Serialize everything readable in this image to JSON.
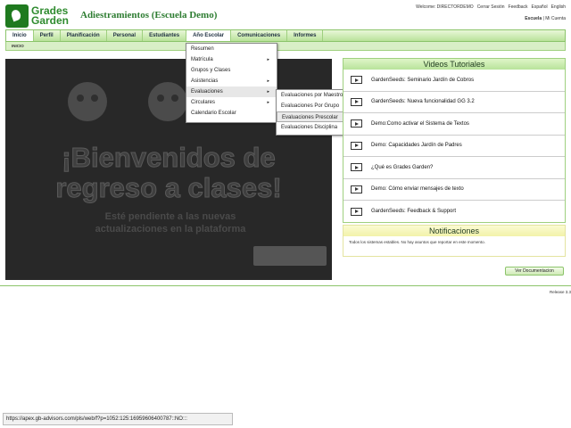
{
  "header": {
    "logo_line1": "Grades",
    "logo_line2": "Garden",
    "app_title": "Adiestramientos (Escuela Demo)",
    "welcome": "Welcome: DIRECTORDEMO",
    "logout": "Cerrar Sesión",
    "feedback": "Feedback",
    "lang_es": "Español",
    "lang_en": "English",
    "school": "Escuela",
    "separator": "|",
    "my_account": "Mi Cuenta"
  },
  "nav": {
    "items": [
      "Inicio",
      "Perfil",
      "Planificación",
      "Personal",
      "Estudiantes",
      "Año Escolar",
      "Comunicaciones",
      "Informes"
    ],
    "breadcrumb": "INICIO"
  },
  "menu_main": {
    "items": [
      {
        "label": "Resumen",
        "arrow": ""
      },
      {
        "label": "Matrícula",
        "arrow": "▸"
      },
      {
        "label": "Grupos y Clases",
        "arrow": ""
      },
      {
        "label": "Asistencias",
        "arrow": "▸"
      },
      {
        "label": "Evaluaciones",
        "arrow": "▸"
      },
      {
        "label": "Circulares",
        "arrow": "▸"
      },
      {
        "label": "Calendario Escolar",
        "arrow": ""
      }
    ]
  },
  "menu_sub": {
    "items": [
      "Evaluaciones por Maestro",
      "Evaluaciones Por Grupo",
      "Evaluaciones Prescolar",
      "Evaluaciones Disciplina"
    ]
  },
  "banner": {
    "line1": "¡Bienvenidos de",
    "line2": "regreso a clases!",
    "sub1": "Esté pendiente a las nuevas",
    "sub2": "actualizaciones en la plataforma"
  },
  "videos": {
    "title": "Videos Tutoriales",
    "items": [
      "GardenSeeds: Seminario Jardín de Cobros",
      "GardenSeeds: Nueva funcionalidad GG 3.2",
      "Demo:Como activar el Sistema de Textos",
      "Demo: Capacidades Jardín de Padres",
      "¿Qué es Grades Garden?",
      "Demo: Cómo enviar mensajes de texto",
      "GardenSeeds: Feedback & Support"
    ]
  },
  "notifications": {
    "title": "Notificaciones",
    "text": "Todos los sistemas estables. No hay asuntos que reportar en este momento."
  },
  "doc_button": "Ver Documentacion",
  "release": "Release 3.3",
  "status_url": "https://apex.gb-advisors.com/pls/web/f?p=1052:125:16959606400787::NO:::",
  "colors": {
    "accent_green": "#2e7d32",
    "nav_green": "#b9e29a",
    "notif_yellow": "#f2f2a9"
  }
}
